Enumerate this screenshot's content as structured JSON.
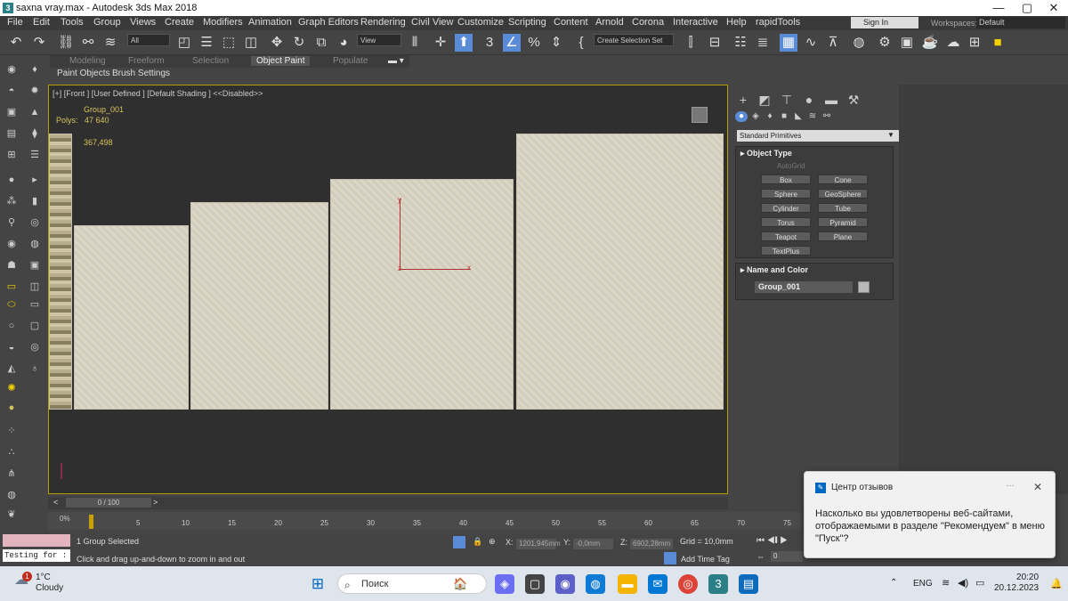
{
  "titlebar": {
    "title": "saxna vray.max - Autodesk 3ds Max 2018",
    "minimize": "—",
    "maximize": "▢",
    "close": "✕"
  },
  "menu": [
    "File",
    "Edit",
    "Tools",
    "Group",
    "Views",
    "Create",
    "Modifiers",
    "Animation",
    "Graph Editors",
    "Rendering",
    "Civil View",
    "Customize",
    "Scripting",
    "Content",
    "Arnold",
    "Corona",
    "Interactive",
    "Help",
    "rapidTools"
  ],
  "signin": {
    "label": "Sign In"
  },
  "workspaces": {
    "label": "Workspaces:",
    "value": "Default"
  },
  "toolbar": {
    "filter": "All",
    "refcoord": "View",
    "selset": "Create Selection Set"
  },
  "ribbon": {
    "tabs": [
      "Modeling",
      "Freeform",
      "Selection",
      "Object Paint",
      "Populate"
    ],
    "active": "Object Paint",
    "subtabs": [
      "Paint Objects",
      "Brush Settings"
    ]
  },
  "viewport": {
    "label": "[+] [Front ] [User Defined ] [Default Shading ]  <<Disabled>>",
    "stats_name": "Group_001",
    "polys_label": "Polys:",
    "polys_value": "47 640",
    "verts_value": "367,498",
    "axis_z": "z",
    "axis_y": "y",
    "axis_x": "x"
  },
  "command_panel": {
    "dropdown": "Standard Primitives",
    "object_type": {
      "title": "Object Type",
      "autogrid": "AutoGrid",
      "buttons": [
        "Box",
        "Cone",
        "Sphere",
        "GeoSphere",
        "Cylinder",
        "Tube",
        "Torus",
        "Pyramid",
        "Teapot",
        "Plane",
        "TextPlus"
      ]
    },
    "name_color": {
      "title": "Name and Color",
      "name": "Group_001",
      "color": "#b8b8b8"
    }
  },
  "timeline": {
    "slider": "0 / 100",
    "prev": "<",
    "next": ">",
    "ticks": [
      "0",
      "5",
      "10",
      "15",
      "20",
      "25",
      "30",
      "35",
      "40",
      "45",
      "50",
      "55",
      "60",
      "65",
      "70",
      "75"
    ],
    "percent": "0%"
  },
  "status": {
    "selected": "1 Group Selected",
    "prompt": "Click and drag up-and-down to zoom in and out",
    "script_text": "Testing for :",
    "x_label": "X:",
    "x_value": "1201,945mm",
    "y_label": "Y:",
    "y_value": "-0,0mm",
    "z_label": "Z:",
    "z_value": "6902,28mm",
    "grid": "Grid = 10,0mm",
    "add_time_tag": "Add Time Tag",
    "frame": "0"
  },
  "notification": {
    "header": "Центр отзывов",
    "body": "Насколько вы удовлетворены веб-сайтами, отображаемыми в разделе \"Рекомендуем\" в меню \"Пуск\"?",
    "dots": "···",
    "close": "✕"
  },
  "taskbar": {
    "search": "Поиск",
    "weather_temp": "1°C",
    "weather_desc": "Cloudy",
    "weather_badge": "1",
    "lang": "ENG",
    "time": "20:20",
    "date": "20.12.2023"
  },
  "colors": {
    "accent": "#5a8bd6",
    "viewport_border": "#b2a000",
    "stats_text": "#d6c25a"
  }
}
